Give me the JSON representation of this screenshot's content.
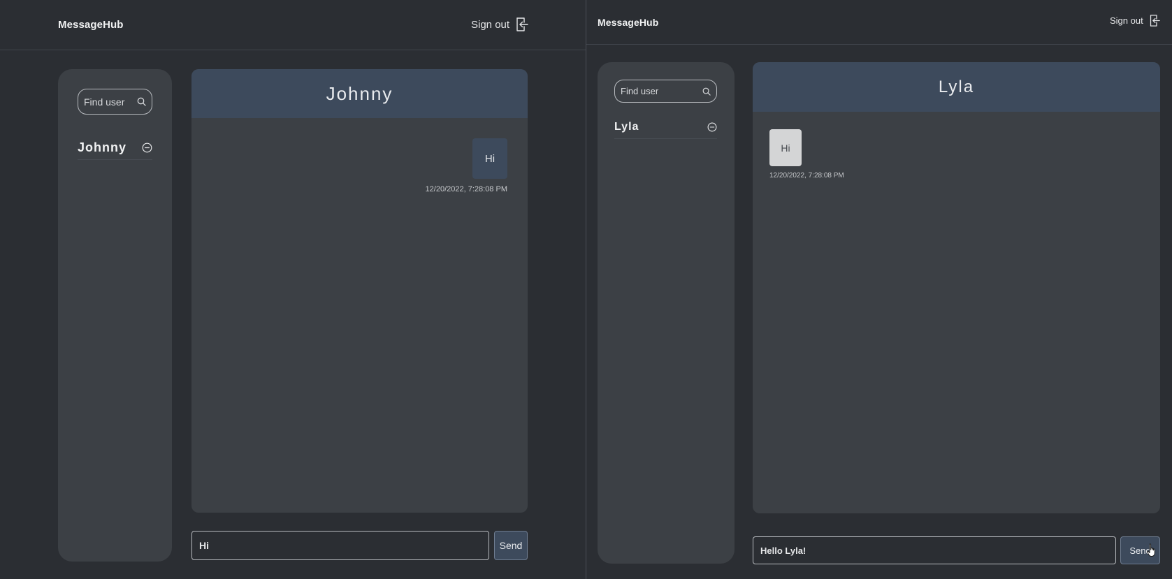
{
  "left_window": {
    "brand": "MessageHub",
    "sign_out_label": "Sign out",
    "search_placeholder": "Find user",
    "contacts": [
      {
        "name": "Johnny"
      }
    ],
    "chat": {
      "title": "Johnny",
      "messages": [
        {
          "text": "Hi",
          "timestamp": "12/20/2022, 7:28:08 PM",
          "direction": "outgoing"
        }
      ]
    },
    "composer": {
      "value": "Hi",
      "send_label": "Send"
    }
  },
  "right_window": {
    "brand": "MessageHub",
    "sign_out_label": "Sign out",
    "search_placeholder": "Find user",
    "contacts": [
      {
        "name": "Lyla"
      }
    ],
    "chat": {
      "title": "Lyla",
      "messages": [
        {
          "text": "Hi",
          "timestamp": "12/20/2022, 7:28:08 PM",
          "direction": "incoming"
        }
      ]
    },
    "composer": {
      "value": "Hello Lyla!",
      "send_label": "Send"
    }
  },
  "icons": {
    "sign_out": "sign-out-icon",
    "search": "search-icon",
    "remove_contact": "minus-circle-icon",
    "cursor": "hand-pointer-icon"
  },
  "colors": {
    "background": "#2b2e33",
    "panel": "#3c4045",
    "accent": "#3d4a5c",
    "incoming_bubble": "#d4d5d6"
  }
}
